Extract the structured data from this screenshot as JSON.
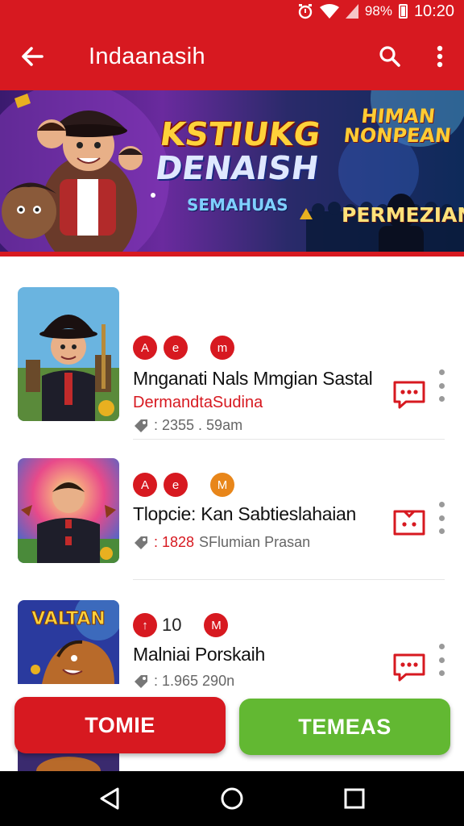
{
  "status_bar": {
    "battery": "98%",
    "time": "10:20"
  },
  "app_bar": {
    "title": "Indaanasih",
    "back_icon": "arrow-left-icon",
    "search_icon": "search-icon",
    "more_icon": "more-vert-icon"
  },
  "banner": {
    "title_line1": "KSTIUKG",
    "title_line2": "DENAISH",
    "subtitle": "SEMAHUAS",
    "right_title_line1": "HIMAN",
    "right_title_line2": "NONPEAN",
    "right_bottom": "PERMEZIAN"
  },
  "items": [
    {
      "title": "Mnganati Nals Mmgian Sastal",
      "subtitle": "DermandtaSudina",
      "meta": ": 2355 . 59am",
      "meta_highlight": "",
      "badges": [
        "A",
        "e",
        "m"
      ]
    },
    {
      "title": "Tlopcie: Kan Sabtieslahaian",
      "subtitle": "",
      "meta": "SFlumian Prasan",
      "meta_highlight": ": 1828",
      "badges": [
        "A",
        "e",
        "M"
      ]
    },
    {
      "title": "Malniai Porskaih",
      "subtitle": "",
      "meta": ": 1.965  290n",
      "meta_highlight": "",
      "badge_count": "10",
      "badges": [
        "↑",
        "M"
      ]
    }
  ],
  "buttons": {
    "left_label": "TOMIE",
    "right_label": "TEMEAS"
  },
  "colors": {
    "primary_red": "#d71920",
    "accent_green": "#62b832",
    "badge_orange": "#e8861a"
  }
}
